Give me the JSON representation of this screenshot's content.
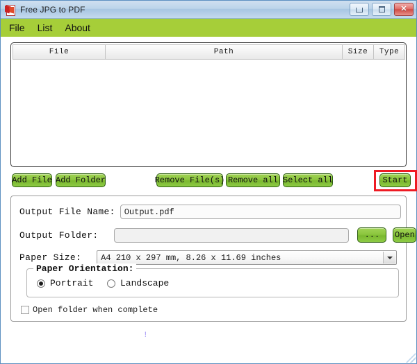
{
  "window": {
    "title": "Free JPG to PDF",
    "icon": "pdf-app-icon",
    "caption_buttons": {
      "minimize": "minimize",
      "maximize": "maximize",
      "close": "✕"
    }
  },
  "menubar": {
    "items": [
      {
        "label": "File"
      },
      {
        "label": "List"
      },
      {
        "label": "About"
      }
    ]
  },
  "filelist": {
    "columns": [
      {
        "label": "File"
      },
      {
        "label": "Path"
      },
      {
        "label": "Size"
      },
      {
        "label": "Type"
      }
    ],
    "rows": []
  },
  "toolbar": {
    "add_file": "Add File",
    "add_folder": "Add Folder",
    "remove_files": "Remove File(s)",
    "remove_all": "Remove all",
    "select_all": "Select all",
    "start": "Start",
    "highlight_color": "#ee1b24"
  },
  "options": {
    "output_file_name_label": "Output File Name:",
    "output_file_name_value": "Output.pdf",
    "output_folder_label": "Output Folder:",
    "output_folder_value": "",
    "browse_button": "...",
    "open_button": "Open",
    "paper_size_label": "Paper Size:",
    "paper_size_value": "A4 210 x 297 mm, 8.26 x 11.69 inches",
    "orientation_group_label": "Paper Orientation:",
    "orientation_portrait": "Portrait",
    "orientation_landscape": "Landscape",
    "orientation_selected": "Portrait",
    "open_folder_label": "Open folder when complete",
    "open_folder_checked": false
  },
  "status": {
    "mark": "!"
  },
  "colors": {
    "menubar": "#a6ce39",
    "button_green": "#8cc63f",
    "titlebar": "#bcd4ea",
    "window_border": "#5c8fc0"
  }
}
